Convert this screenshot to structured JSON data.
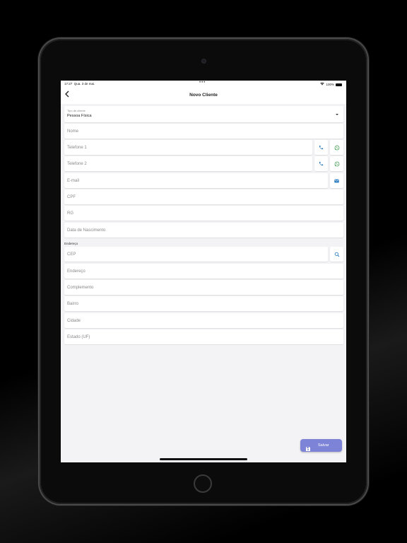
{
  "status_bar": {
    "time": "17:27",
    "date": "Qua. 3 de mai.",
    "dots": "•••",
    "battery_pct": "100%"
  },
  "header": {
    "title": "Novo Cliente"
  },
  "client_type": {
    "label": "Tipo de cliente",
    "value": "Pessoa Física"
  },
  "fields": {
    "nome": "Nome",
    "telefone1": "Telefone 1",
    "telefone2": "Telefone 2",
    "email": "E-mail",
    "cpf": "CPF",
    "rg": "RG",
    "nascimento": "Data de Nascimento"
  },
  "address": {
    "section_label": "Endereço",
    "cep": "CEP",
    "endereco": "Endereço",
    "complemento": "Complemento",
    "bairro": "Bairro",
    "cidade": "Cidade",
    "estado": "Estado (UF)"
  },
  "actions": {
    "save_label": "Salvar"
  },
  "icons": {
    "phone": "phone-icon",
    "whatsapp": "whatsapp-icon",
    "mail": "mail-icon",
    "search": "search-icon",
    "save": "floppy-disk-icon"
  },
  "colors": {
    "accent": "#2b7bbf",
    "whatsapp": "#3a9b4a",
    "fab": "#7d83d6",
    "background": "#f3f3f5"
  }
}
